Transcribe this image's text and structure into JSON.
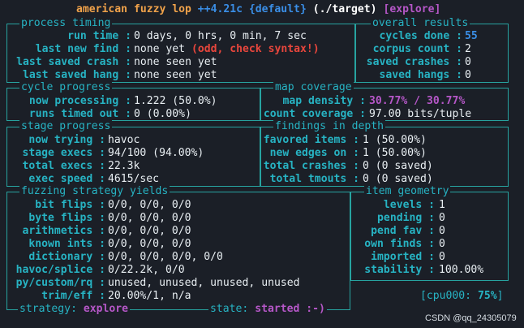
{
  "header": {
    "app": "american fuzzy lop",
    "version": "++4.21c",
    "instance": "{default}",
    "target": "(./target)",
    "mode": "[explore]"
  },
  "process_timing": {
    "title": "process timing",
    "run_time_label": "run time :",
    "run_time": "0 days, 0 hrs, 0 min, 7 sec",
    "last_new_find_label": "last new find :",
    "last_new_find": "none yet",
    "last_new_find_warn": "(odd, check syntax!)",
    "last_saved_crash_label": "last saved crash :",
    "last_saved_crash": "none seen yet",
    "last_saved_hang_label": "last saved hang :",
    "last_saved_hang": "none seen yet"
  },
  "overall_results": {
    "title": "overall results",
    "cycles_done_label": "cycles done :",
    "cycles_done": "55",
    "corpus_count_label": "corpus count :",
    "corpus_count": "2",
    "saved_crashes_label": "saved crashes :",
    "saved_crashes": "0",
    "saved_hangs_label": "saved hangs :",
    "saved_hangs": "0"
  },
  "cycle_progress": {
    "title": "cycle progress",
    "now_processing_label": "now processing :",
    "now_processing": "1.222 (50.0%)",
    "runs_timed_out_label": "runs timed out :",
    "runs_timed_out": "0 (0.00%)"
  },
  "map_coverage": {
    "title": "map coverage",
    "map_density_label": "map density :",
    "map_density": "30.77% / 30.77%",
    "count_coverage_label": "count coverage :",
    "count_coverage": "97.00 bits/tuple"
  },
  "stage_progress": {
    "title": "stage progress",
    "now_trying_label": "now trying :",
    "now_trying": "havoc",
    "stage_execs_label": "stage execs :",
    "stage_execs": "94/100 (94.00%)",
    "total_execs_label": "total execs :",
    "total_execs": "22.3k",
    "exec_speed_label": "exec speed :",
    "exec_speed": "4615/sec"
  },
  "findings": {
    "title": "findings in depth",
    "favored_items_label": "favored items :",
    "favored_items": "1 (50.00%)",
    "new_edges_on_label": "new edges on :",
    "new_edges_on": "1 (50.00%)",
    "total_crashes_label": "total crashes :",
    "total_crashes": "0 (0 saved)",
    "total_tmouts_label": "total tmouts :",
    "total_tmouts": "0 (0 saved)"
  },
  "strategy_yields": {
    "title": "fuzzing strategy yields",
    "rows": [
      {
        "label": "bit flips :",
        "value": "0/0, 0/0, 0/0"
      },
      {
        "label": "byte flips :",
        "value": "0/0, 0/0, 0/0"
      },
      {
        "label": "arithmetics :",
        "value": "0/0, 0/0, 0/0"
      },
      {
        "label": "known ints :",
        "value": "0/0, 0/0, 0/0"
      },
      {
        "label": "dictionary :",
        "value": "0/0, 0/0, 0/0, 0/0"
      },
      {
        "label": "havoc/splice :",
        "value": "0/22.2k, 0/0"
      },
      {
        "label": "py/custom/rq :",
        "value": "unused, unused, unused, unused"
      },
      {
        "label": "trim/eff :",
        "value": "20.00%/1, n/a"
      }
    ]
  },
  "item_geometry": {
    "title": "item geometry",
    "levels_label": "levels :",
    "levels": "1",
    "pending_label": "pending :",
    "pending": "0",
    "pend_fav_label": "pend fav :",
    "pend_fav": "0",
    "own_finds_label": "own finds :",
    "own_finds": "0",
    "imported_label": "imported :",
    "imported": "0",
    "stability_label": "stability :",
    "stability": "100.00%"
  },
  "cpu": {
    "prefix": "[cpu000:",
    "value": "75%",
    "suffix": "]"
  },
  "footer": {
    "strategy_label": "strategy:",
    "strategy": "explore",
    "state_label": "state:",
    "state": "started :-)"
  },
  "watermark": "CSDN @qq_24305079"
}
